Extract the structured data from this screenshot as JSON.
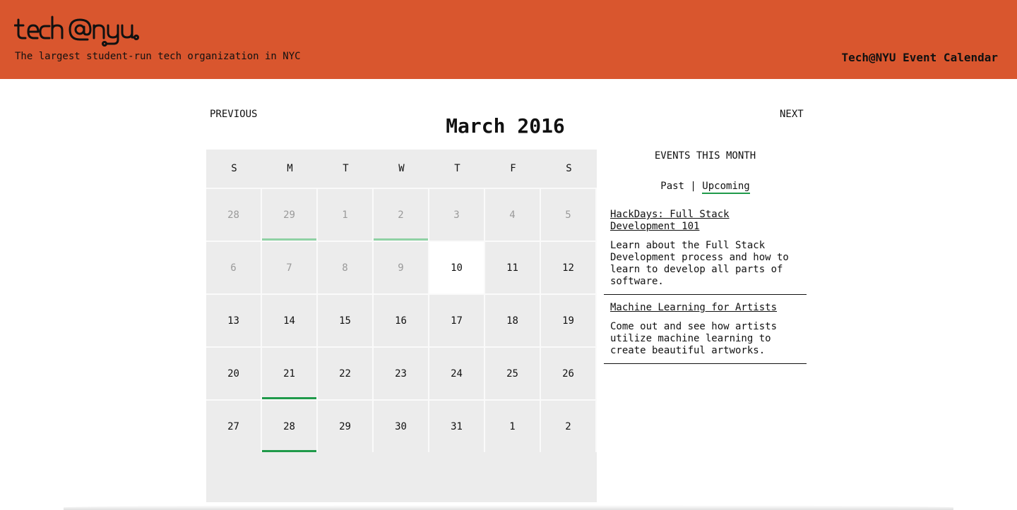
{
  "colors": {
    "header_bg": "#d9562e",
    "event_past_marker": "#8fd1a4",
    "event_upcoming_marker": "#1f9a4a",
    "cell_bg": "#ececec",
    "today_bg": "#ffffff"
  },
  "header": {
    "logo_text": "tech@nyu",
    "tagline": "The largest student-run tech organization in NYC",
    "title": "Tech@NYU Event Calendar"
  },
  "nav": {
    "previous": "PREVIOUS",
    "next": "NEXT",
    "month_title": "March 2016"
  },
  "calendar": {
    "weekdays": [
      "S",
      "M",
      "T",
      "W",
      "T",
      "F",
      "S"
    ],
    "weeks": [
      [
        {
          "day": "28",
          "muted": true
        },
        {
          "day": "29",
          "muted": true,
          "event": "past"
        },
        {
          "day": "1",
          "muted": true
        },
        {
          "day": "2",
          "muted": true,
          "event": "past"
        },
        {
          "day": "3",
          "muted": true
        },
        {
          "day": "4",
          "muted": true
        },
        {
          "day": "5",
          "muted": true
        }
      ],
      [
        {
          "day": "6",
          "muted": true
        },
        {
          "day": "7",
          "muted": true
        },
        {
          "day": "8",
          "muted": true
        },
        {
          "day": "9",
          "muted": true
        },
        {
          "day": "10",
          "today": true
        },
        {
          "day": "11"
        },
        {
          "day": "12"
        }
      ],
      [
        {
          "day": "13"
        },
        {
          "day": "14"
        },
        {
          "day": "15"
        },
        {
          "day": "16"
        },
        {
          "day": "17"
        },
        {
          "day": "18"
        },
        {
          "day": "19"
        }
      ],
      [
        {
          "day": "20"
        },
        {
          "day": "21",
          "event": "upcoming"
        },
        {
          "day": "22"
        },
        {
          "day": "23"
        },
        {
          "day": "24"
        },
        {
          "day": "25"
        },
        {
          "day": "26"
        }
      ],
      [
        {
          "day": "27"
        },
        {
          "day": "28",
          "event": "upcoming"
        },
        {
          "day": "29"
        },
        {
          "day": "30"
        },
        {
          "day": "31"
        },
        {
          "day": "1"
        },
        {
          "day": "2"
        }
      ]
    ]
  },
  "events_panel": {
    "title": "EVENTS THIS MONTH",
    "tab_past": "Past",
    "separator": "|",
    "tab_upcoming": "Upcoming",
    "active_tab": "upcoming",
    "events": [
      {
        "title": "HackDays: Full Stack Development 101",
        "description": "Learn about the Full Stack Development process and how to learn to develop all parts of software."
      },
      {
        "title": "Machine Learning for Artists",
        "description": "Come out and see how artists utilize machine learning to create beautiful artworks."
      }
    ]
  }
}
